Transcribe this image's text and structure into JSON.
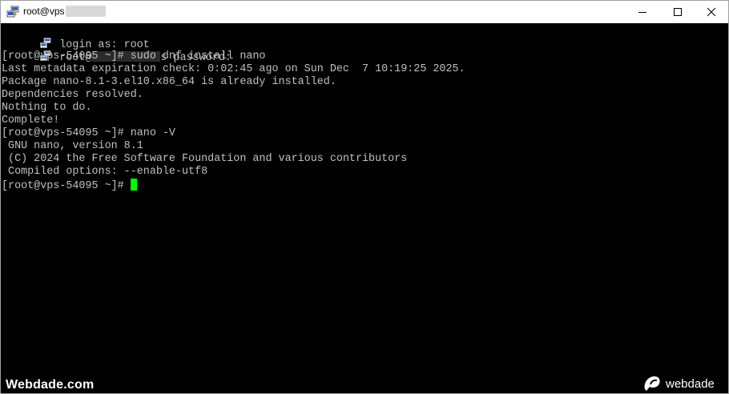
{
  "window": {
    "title": "root@vps",
    "controls": {
      "minimize_icon": "minimize-icon",
      "maximize_icon": "maximize-icon",
      "close_icon": "close-icon"
    }
  },
  "terminal": {
    "colors": {
      "background": "#000000",
      "text": "#c0c0c0",
      "cursor": "#00ff00"
    },
    "lines": [
      {
        "text": "login as: root"
      },
      {
        "prefix": "root@",
        "suffix": "s password:"
      },
      {
        "text": "[root@vps-54095 ~]# sudo dnf install nano"
      },
      {
        "text": "Last metadata expiration check: 0:02:45 ago on Sun Dec  7 10:19:25 2025."
      },
      {
        "text": "Package nano-8.1-3.el10.x86_64 is already installed."
      },
      {
        "text": "Dependencies resolved."
      },
      {
        "text": "Nothing to do."
      },
      {
        "text": "Complete!"
      },
      {
        "text": "[root@vps-54095 ~]# nano -V"
      },
      {
        "text": " GNU nano, version 8.1"
      },
      {
        "text": " (C) 2024 the Free Software Foundation and various contributors"
      },
      {
        "text": " Compiled options: --enable-utf8"
      },
      {
        "text": "[root@vps-54095 ~]#"
      }
    ]
  },
  "watermarks": {
    "left": "Webdade.com",
    "right": "webdade"
  }
}
